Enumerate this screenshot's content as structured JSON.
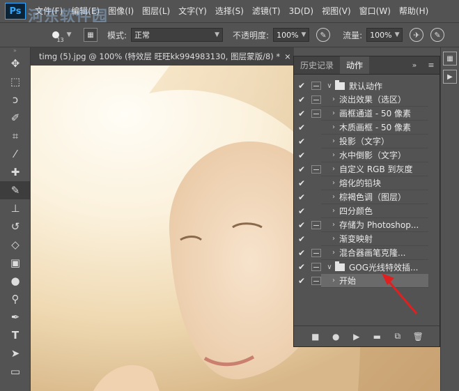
{
  "app": {
    "logo_text": "Ps"
  },
  "watermark": {
    "text": "河东软件园",
    "url": "www.pc0359.cn"
  },
  "menu": [
    "文件(F)",
    "编辑(E)",
    "图像(I)",
    "图层(L)",
    "文字(Y)",
    "选择(S)",
    "滤镜(T)",
    "3D(D)",
    "视图(V)",
    "窗口(W)",
    "帮助(H)"
  ],
  "options": {
    "brush_size": "13",
    "mode_label": "模式:",
    "mode_value": "正常",
    "opacity_label": "不透明度:",
    "opacity_value": "100%",
    "flow_label": "流量:",
    "flow_value": "100%"
  },
  "document": {
    "tab_title": "timg (5).jpg @ 100% (特效层 旺旺kk994983130, 图层蒙版/8) *",
    "close": "×"
  },
  "panel": {
    "tabs": [
      "历史记录",
      "动作"
    ],
    "active_tab": 1,
    "collapse": "»",
    "menu": "≡",
    "sets": [
      {
        "name": "默认动作",
        "expanded": true,
        "actions": [
          {
            "name": "淡出效果（选区）",
            "dialog": true
          },
          {
            "name": "画框通道 - 50 像素",
            "dialog": true
          },
          {
            "name": "木质画框 - 50 像素",
            "dialog": false
          },
          {
            "name": "投影（文字）",
            "dialog": false
          },
          {
            "name": "水中倒影（文字）",
            "dialog": false
          },
          {
            "name": "自定义 RGB 到灰度",
            "dialog": true
          },
          {
            "name": "熔化的铅块",
            "dialog": false
          },
          {
            "name": "棕褐色调（图层）",
            "dialog": false
          },
          {
            "name": "四分颜色",
            "dialog": false
          },
          {
            "name": "存储为 Photoshop...",
            "dialog": true
          },
          {
            "name": "渐变映射",
            "dialog": false
          },
          {
            "name": "混合器画笔克隆...",
            "dialog": true
          }
        ]
      },
      {
        "name": "GOG光线特效插...",
        "expanded": true,
        "actions": [
          {
            "name": "开始",
            "dialog": true,
            "selected": true
          }
        ]
      }
    ],
    "footer_buttons": [
      "stop-icon",
      "record-icon",
      "play-icon",
      "new-set-icon",
      "new-action-icon",
      "delete-icon"
    ]
  },
  "colors": {
    "accent": "#31a8ff",
    "arrow": "#e02020",
    "panel_bg": "#535353"
  }
}
